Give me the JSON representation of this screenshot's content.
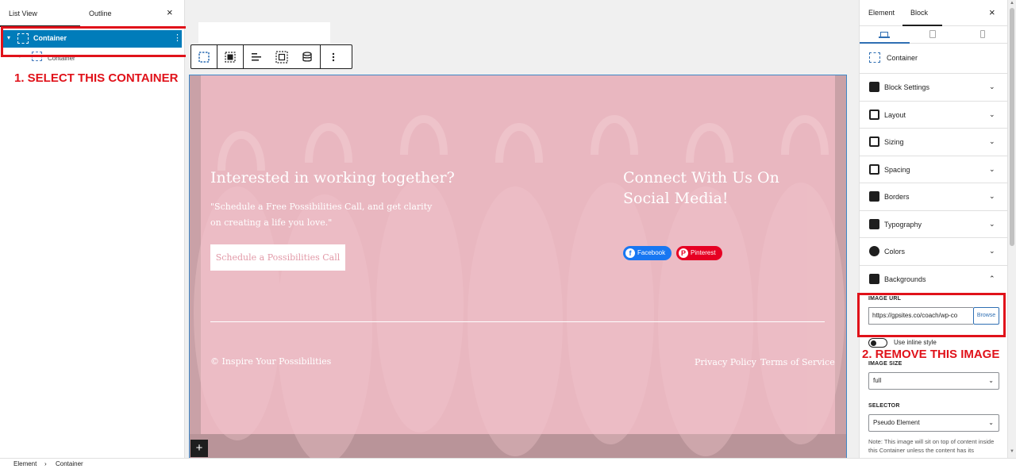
{
  "left_panel": {
    "tab_list_view": "List View",
    "tab_outline": "Outline",
    "close_symbol": "×",
    "tree": {
      "selected_label": "Container",
      "child_label": "Container"
    },
    "annotation": "1. SELECT THIS CONTAINER"
  },
  "toolbar": {
    "icons": [
      "container-icon",
      "select-parent-icon",
      "align-icon",
      "padding-icon",
      "database-icon",
      "more-options-icon"
    ]
  },
  "hero": {
    "title": "Interested in working together?",
    "text": "\"Schedule a Free Possibilities Call, and get clarity on creating a life you love.\"",
    "cta_label": "Schedule a Possibilities Call",
    "social_heading": "Connect With Us On Social Media!",
    "facebook_label": "Facebook",
    "facebook_icon_glyph": "f",
    "pinterest_label": "Pinterest",
    "pinterest_icon_glyph": "P",
    "copyright": "© Inspire Your Possibilities",
    "privacy_label": "Privacy Policy",
    "terms_label": "Terms of Service",
    "add_symbol": "+"
  },
  "right_panel": {
    "tab_element": "Element",
    "tab_block": "Block",
    "close_symbol": "×",
    "block_title": "Container",
    "sections": [
      {
        "label": "Block Settings",
        "icon": "block-settings-icon",
        "expanded": false
      },
      {
        "label": "Layout",
        "icon": "layout-icon",
        "expanded": false
      },
      {
        "label": "Sizing",
        "icon": "sizing-icon",
        "expanded": false
      },
      {
        "label": "Spacing",
        "icon": "spacing-icon",
        "expanded": false
      },
      {
        "label": "Borders",
        "icon": "borders-icon",
        "expanded": false
      },
      {
        "label": "Typography",
        "icon": "typography-icon",
        "expanded": false
      },
      {
        "label": "Colors",
        "icon": "colors-icon",
        "expanded": false
      },
      {
        "label": "Backgrounds",
        "icon": "backgrounds-icon",
        "expanded": true
      }
    ],
    "image_url_label": "IMAGE URL",
    "image_url_value": "https://gpsites.co/coach/wp-co",
    "browse_label": "Browse",
    "inline_style_label": "Use inline style",
    "image_size_label": "IMAGE SIZE",
    "image_size_value": "full",
    "selector_label": "SELECTOR",
    "selector_value": "Pseudo Element",
    "note": "Note: This image will sit on top of content inside this Container unless the content has its",
    "annotation": "2. REMOVE THIS IMAGE"
  },
  "footer": {
    "crumb_1": "Element",
    "separator": "›",
    "crumb_2": "Container"
  },
  "colors": {
    "accent": "#007cba",
    "annotation_red": "#e0121a",
    "hero_pink": "#e9b7c0",
    "facebook_blue": "#1877f2",
    "pinterest_red": "#e60023"
  }
}
